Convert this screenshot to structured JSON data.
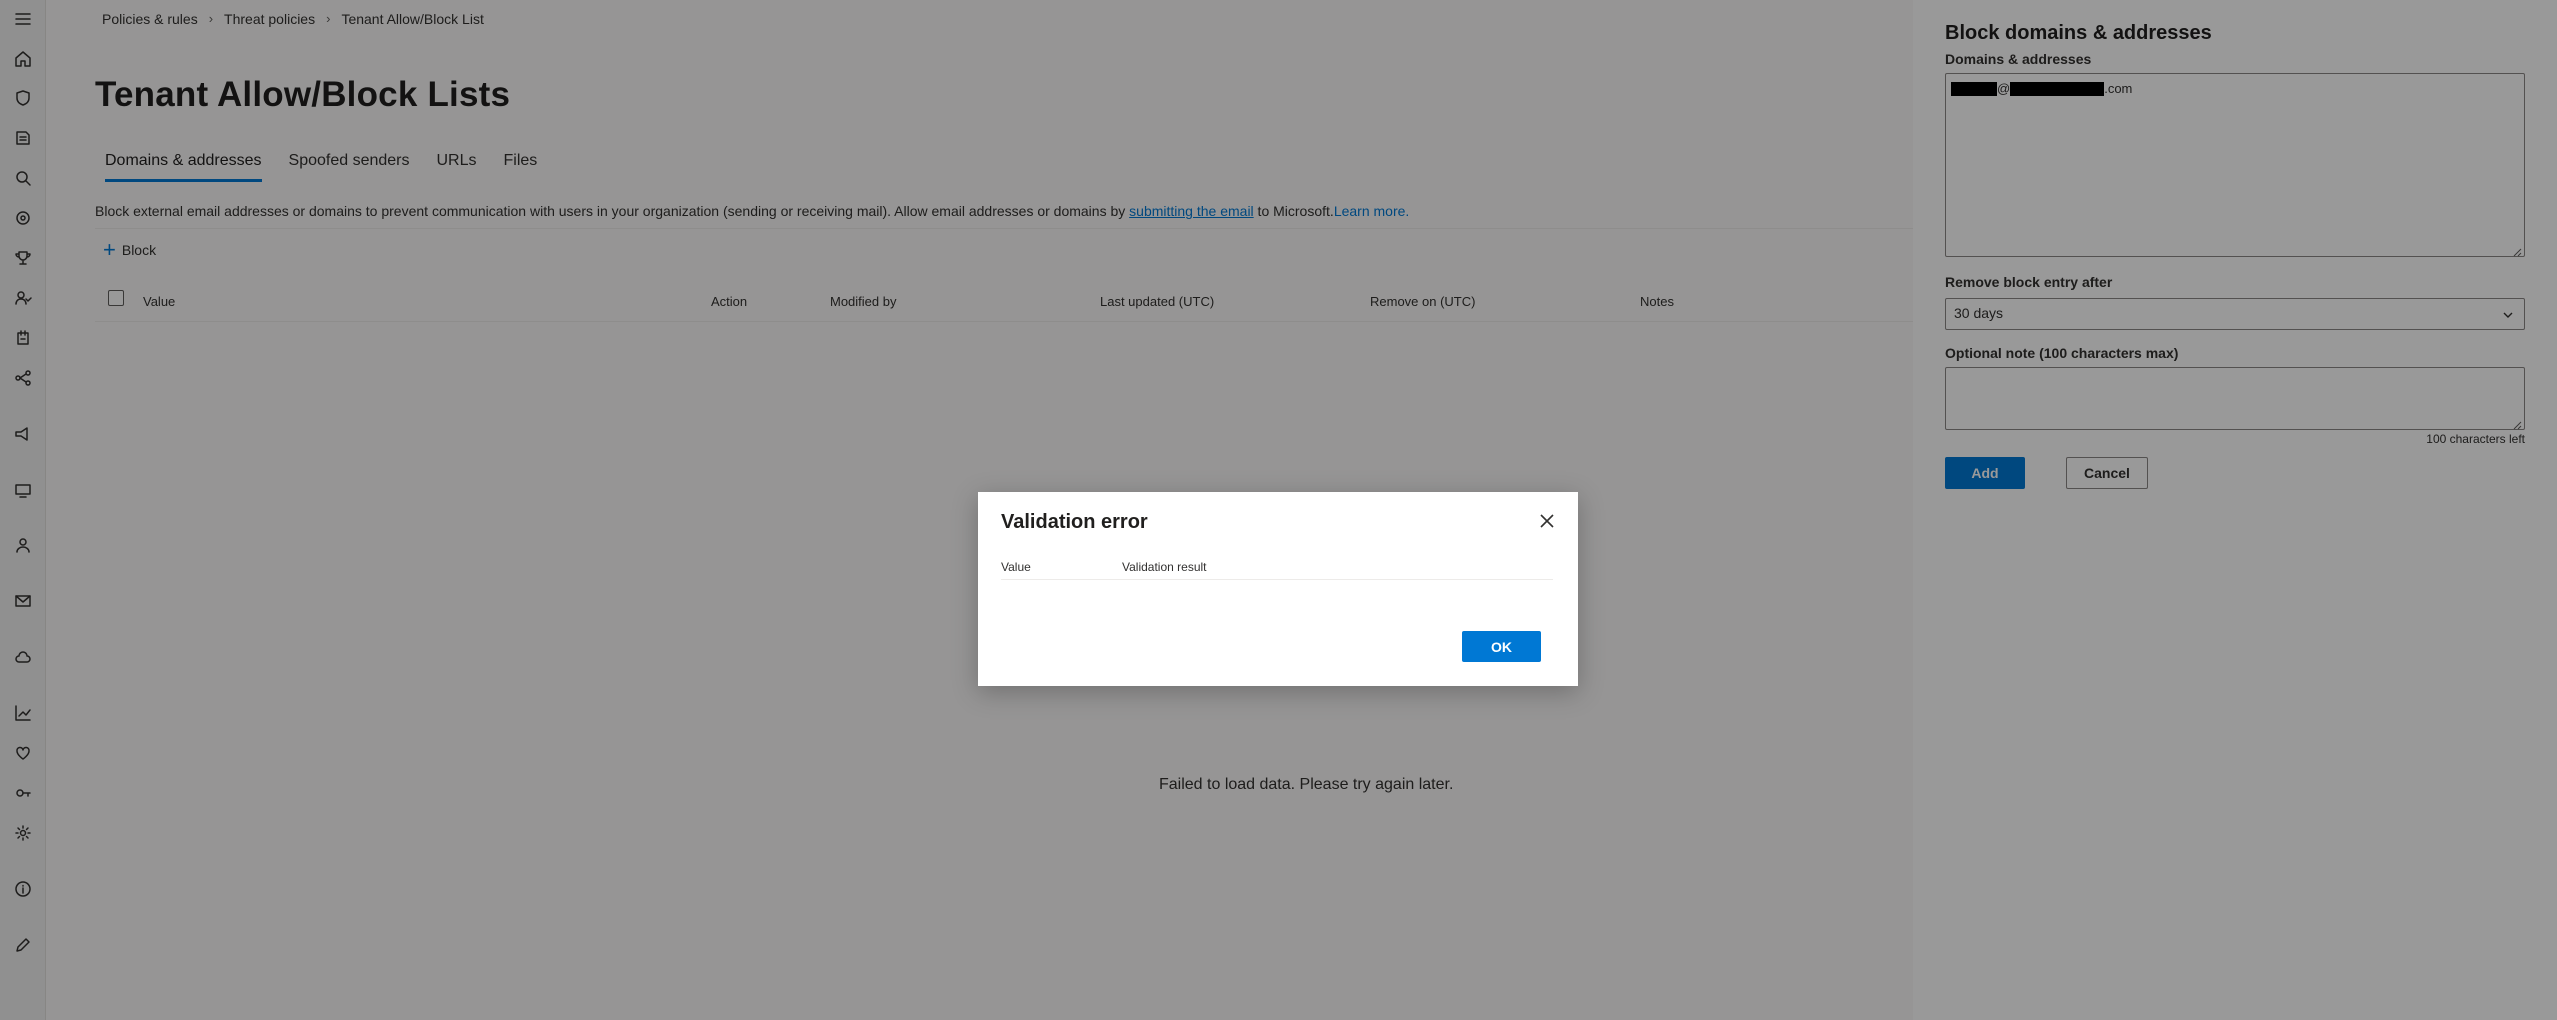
{
  "nav_rail": {
    "icons": [
      "menu-icon",
      "home-icon",
      "shield-icon",
      "incidents-icon",
      "hunting-icon",
      "threat-analytics-icon",
      "trophy-icon",
      "partners-icon",
      "learning-icon",
      "assets-icon",
      "campaigns-icon",
      "devices-icon",
      "identities-icon",
      "email-icon",
      "cloud-icon",
      "reports-icon",
      "health-icon",
      "permissions-icon",
      "settings-icon",
      "info-icon",
      "customize-icon"
    ]
  },
  "breadcrumb": {
    "items": [
      "Policies & rules",
      "Threat policies",
      "Tenant Allow/Block List"
    ]
  },
  "page": {
    "title": "Tenant Allow/Block Lists",
    "tabs": [
      "Domains & addresses",
      "Spoofed senders",
      "URLs",
      "Files"
    ],
    "active_tab": "Domains & addresses",
    "description_prefix": "Block external email addresses or domains to prevent communication with users in your organization (sending or receiving mail). Allow email addresses or domains by ",
    "description_link": "submitting the email",
    "description_middle": " to Microsoft.",
    "description_learn_more": "Learn more.",
    "block_button": "Block",
    "table_columns": [
      "Value",
      "Action",
      "Modified by",
      "Last updated (UTC)",
      "Remove on (UTC)",
      "Notes"
    ],
    "empty_message": "Failed to load data. Please try again later."
  },
  "dialog": {
    "title": "Validation error",
    "columns": [
      "Value",
      "Validation result"
    ],
    "ok_label": "OK"
  },
  "panel": {
    "title": "Block domains & addresses",
    "domains_label": "Domains & addresses",
    "domain_value_separator": "@",
    "domain_value_suffix": ".com",
    "remove_label": "Remove block entry after",
    "remove_value": "30 days",
    "note_label": "Optional note (100 characters max)",
    "note_value": "",
    "chars_left": "100 characters left",
    "add_label": "Add",
    "cancel_label": "Cancel"
  },
  "colors": {
    "accent": "#0078d4",
    "overlay": "rgba(0,0,0,0.4)"
  }
}
